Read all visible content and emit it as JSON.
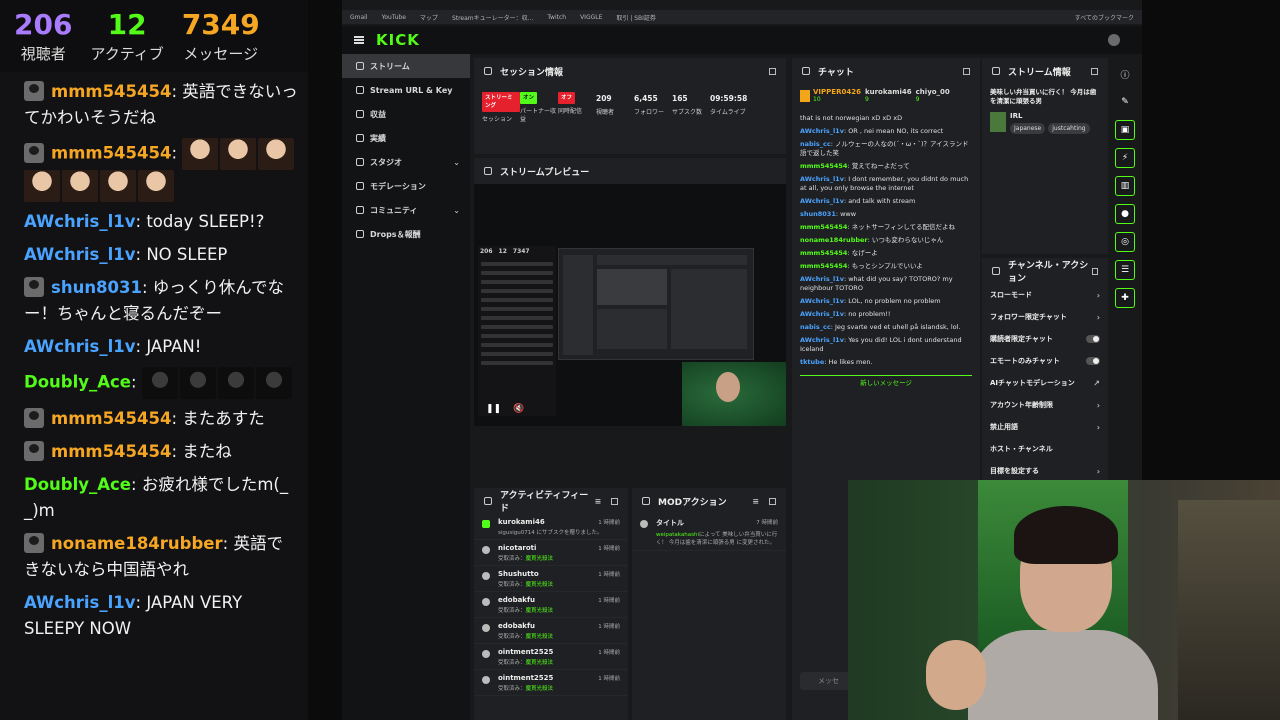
{
  "overlay": {
    "stats": [
      {
        "value": "206",
        "label": "視聴者",
        "color": "#a97bff"
      },
      {
        "value": "12",
        "label": "アクティブ",
        "color": "#53fc18"
      },
      {
        "value": "7349",
        "label": "メッセージ",
        "color": "#f5a623"
      }
    ],
    "messages": [
      {
        "user": "mmm545454",
        "sep": ": ",
        "text": "英語できないってかわいそうだね",
        "color": "#f5a623",
        "avatar": true,
        "emotes": 0
      },
      {
        "user": "mmm545454",
        "sep": ": ",
        "text": "",
        "color": "#f5a623",
        "avatar": true,
        "emotes": 7
      },
      {
        "user": "AWchris_l1v",
        "sep": ": ",
        "text": "today SLEEP!?",
        "color": "#4aa3ff",
        "avatar": false,
        "emotes": 0
      },
      {
        "user": "AWchris_l1v",
        "sep": ": ",
        "text": "NO SLEEP",
        "color": "#4aa3ff",
        "avatar": false,
        "emotes": 0
      },
      {
        "user": "shun8031",
        "sep": ": ",
        "text": "ゆっくり休んでなー！ちゃんと寝るんだぞー",
        "color": "#4aa3ff",
        "avatar": true,
        "emotes": 0
      },
      {
        "user": "AWchris_l1v",
        "sep": ": ",
        "text": "JAPAN!",
        "color": "#4aa3ff",
        "avatar": false,
        "emotes": 0
      },
      {
        "user": "Doubly_Ace",
        "sep": ": ",
        "text": "",
        "color": "#53fc18",
        "avatar": false,
        "emotes": 4
      },
      {
        "user": "mmm545454",
        "sep": ": ",
        "text": "またあすた",
        "color": "#f5a623",
        "avatar": true,
        "emotes": 0
      },
      {
        "user": "mmm545454",
        "sep": ": ",
        "text": "またね",
        "color": "#f5a623",
        "avatar": true,
        "emotes": 0
      },
      {
        "user": "Doubly_Ace",
        "sep": ": ",
        "text": "お疲れ様でしたm(_ _)m",
        "color": "#53fc18",
        "avatar": false,
        "emotes": 0
      },
      {
        "user": "noname184rubber",
        "sep": ": ",
        "text": "英語できないなら中国語やれ",
        "color": "#f5a623",
        "avatar": true,
        "emotes": 0
      },
      {
        "user": "AWchris_l1v",
        "sep": ": ",
        "text": "JAPAN VERY SLEEPY NOW",
        "color": "#4aa3ff",
        "avatar": false,
        "emotes": 0
      }
    ]
  },
  "browser": {
    "bookmarks": [
      "Gmail",
      "YouTube",
      "マップ",
      "Streamキューレーター：収...",
      "Twitch",
      "VIGGLE",
      "取引 | SBI証券"
    ],
    "all_bookmarks": "すべてのブックマーク"
  },
  "dashboard": {
    "logo": "KICK",
    "nav": [
      {
        "label": "ストリーム",
        "active": true,
        "chevron": false
      },
      {
        "label": "Stream URL & Key",
        "active": false,
        "chevron": false
      },
      {
        "label": "収益",
        "active": false,
        "chevron": false
      },
      {
        "label": "実績",
        "active": false,
        "chevron": false
      },
      {
        "label": "スタジオ",
        "active": false,
        "chevron": true
      },
      {
        "label": "モデレーション",
        "active": false,
        "chevron": false
      },
      {
        "label": "コミュニティ",
        "active": false,
        "chevron": true
      },
      {
        "label": "Drops＆報酬",
        "active": false,
        "chevron": false
      }
    ],
    "session": {
      "title": "セッション情報",
      "cells": [
        {
          "badge": "ストリーミング",
          "badge_color": "red",
          "label": "セッション"
        },
        {
          "badge": "オン",
          "badge_color": "green",
          "label": "パートナー収益"
        },
        {
          "badge": "オフ",
          "badge_color": "red",
          "label": "同時配信"
        },
        {
          "value": "209",
          "label": "視聴者"
        },
        {
          "value": "6,455",
          "label": "フォロワー"
        },
        {
          "value": "165",
          "label": "サブスク数"
        },
        {
          "value": "09:59:58",
          "label": "タイムライブ"
        }
      ]
    },
    "preview": {
      "title": "ストリームプレビュー",
      "mini_stats": [
        "206",
        "12",
        "7347"
      ]
    },
    "activity": {
      "title": "アクティビティフィード",
      "items": [
        {
          "user": "kurokami46",
          "detail": "sigusigu0714 にサブスクを贈りました。",
          "time": "1 時間前",
          "type": "sub"
        },
        {
          "user": "nicotaroti",
          "detail": "受取済み：",
          "reward": "魔貫光殺法",
          "time": "1 時間前",
          "type": "reward"
        },
        {
          "user": "Shushutto",
          "detail": "受取済み：",
          "reward": "魔貫光殺法",
          "time": "1 時間前",
          "type": "reward"
        },
        {
          "user": "edobakfu",
          "detail": "受取済み：",
          "reward": "魔貫光殺法",
          "time": "1 時間前",
          "type": "reward"
        },
        {
          "user": "edobakfu",
          "detail": "受取済み：",
          "reward": "魔貫光殺法",
          "time": "1 時間前",
          "type": "reward"
        },
        {
          "user": "ointment2525",
          "detail": "受取済み：",
          "reward": "魔貫光殺法",
          "time": "1 時間前",
          "type": "reward"
        },
        {
          "user": "ointment2525",
          "detail": "受取済み：",
          "reward": "魔貫光殺法",
          "time": "1 時間前",
          "type": "reward"
        }
      ]
    },
    "modactions": {
      "title": "MODアクション",
      "item": {
        "label": "タイトル",
        "time": "7 時間前",
        "user": "weipatakahashi",
        "detail": "によって 美味しい弁当買いに行く！ 今月は歯を清潔に頑張る男 に変更された。"
      }
    },
    "chat": {
      "title": "チャット",
      "top_users": [
        {
          "name": "VIPPER0426",
          "count": "10"
        },
        {
          "name": "kurokami46",
          "count": "9"
        },
        {
          "name": "chiyo_00",
          "count": "9"
        }
      ],
      "messages": [
        {
          "user": "",
          "text": "that is not norwegian xD xD xD",
          "color": "#e0e0e0"
        },
        {
          "user": "AWchris_l1v",
          "text": ": OR , nei mean NO, its correct",
          "color": "#4aa3ff"
        },
        {
          "user": "nabis_cc",
          "text": ": ノルウェーの人なの(´・ω・`)？アイスランド語で返した笑",
          "color": "#4aa3ff"
        },
        {
          "user": "mmm545454",
          "text": ": 覚えてねーよだって",
          "color": "#53fc18"
        },
        {
          "user": "AWchris_l1v",
          "text": ": I dont remember, you didnt do much at all, you only browse the internet",
          "color": "#4aa3ff"
        },
        {
          "user": "AWchris_l1v",
          "text": ": and talk with stream",
          "color": "#4aa3ff"
        },
        {
          "user": "shun8031",
          "text": ": www",
          "color": "#4aa3ff"
        },
        {
          "user": "mmm545454",
          "text": ": ネットサーフィンしてる配信だよね",
          "color": "#53fc18"
        },
        {
          "user": "noname184rubber",
          "text": ": いつも変わらないじゃん",
          "color": "#53fc18"
        },
        {
          "user": "mmm545454",
          "text": ": なげーよ",
          "color": "#53fc18"
        },
        {
          "user": "mmm545454",
          "text": ": もっとシンプルでいいよ",
          "color": "#53fc18"
        },
        {
          "user": "AWchris_l1v",
          "text": ": what did you say? TOTORO? my neighbour TOTORO",
          "color": "#4aa3ff"
        },
        {
          "user": "AWchris_l1v",
          "text": ": LOL, no problem no problem",
          "color": "#4aa3ff"
        },
        {
          "user": "AWchris_l1v",
          "text": ": no problem!!",
          "color": "#4aa3ff"
        },
        {
          "user": "nabis_cc",
          "text": ": Jeg svarte ved et uhell på islandsk, lol.",
          "color": "#4aa3ff"
        },
        {
          "user": "AWchris_l1v",
          "text": ": Yes you did! LOL i dont understand Iceland",
          "color": "#4aa3ff"
        },
        {
          "user": "tktube",
          "text": ": He likes men.",
          "color": "#4aa3ff"
        }
      ],
      "new_messages": "新しいメッセージ",
      "input_placeholder": "メッセ"
    },
    "streaminfo": {
      "title": "ストリーム情報",
      "stream_title": "美味しい弁当買いに行く！ 今月は歯を清潔に頑張る男",
      "category": "IRL",
      "tags": [
        "Japanese",
        "justcahting"
      ]
    },
    "channel_actions": {
      "title": "チャンネル・アクション",
      "items": [
        {
          "label": "スローモード",
          "kind": "arrow"
        },
        {
          "label": "フォロワー限定チャット",
          "kind": "arrow"
        },
        {
          "label": "購読者限定チャット",
          "kind": "toggle"
        },
        {
          "label": "エモートのみチャット",
          "kind": "toggle"
        },
        {
          "label": "AIチャットモデレーション",
          "kind": "link"
        },
        {
          "label": "アカウント年齢制限",
          "kind": "arrow"
        },
        {
          "label": "禁止用語",
          "kind": "arrow"
        },
        {
          "label": "ホスト・チャンネル",
          "kind": "none"
        },
        {
          "label": "目標を設定する",
          "kind": "arrow"
        }
      ]
    }
  }
}
